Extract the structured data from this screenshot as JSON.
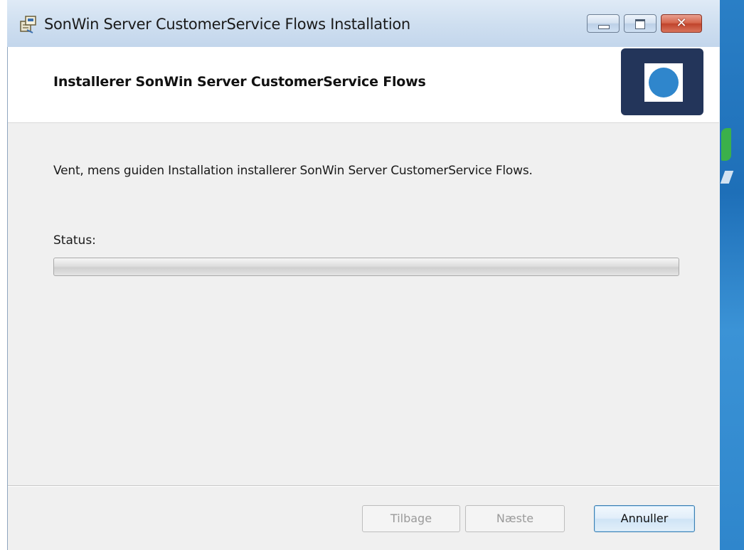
{
  "window": {
    "title": "SonWin Server CustomerService Flows Installation",
    "controls": {
      "minimize_icon": "minimize-icon",
      "maximize_icon": "maximize-icon",
      "close_glyph": "✕"
    }
  },
  "banner": {
    "title": "Installerer SonWin Server CustomerService Flows",
    "logo_colors": {
      "background": "#23355a",
      "dot": "#2f86cc"
    }
  },
  "body": {
    "message": "Vent, mens guiden Installation installerer SonWin Server CustomerService Flows.",
    "status_label": "Status:",
    "progress_fraction": 0
  },
  "buttons": {
    "back": "Tilbage",
    "next": "Næste",
    "cancel": "Annuller"
  }
}
